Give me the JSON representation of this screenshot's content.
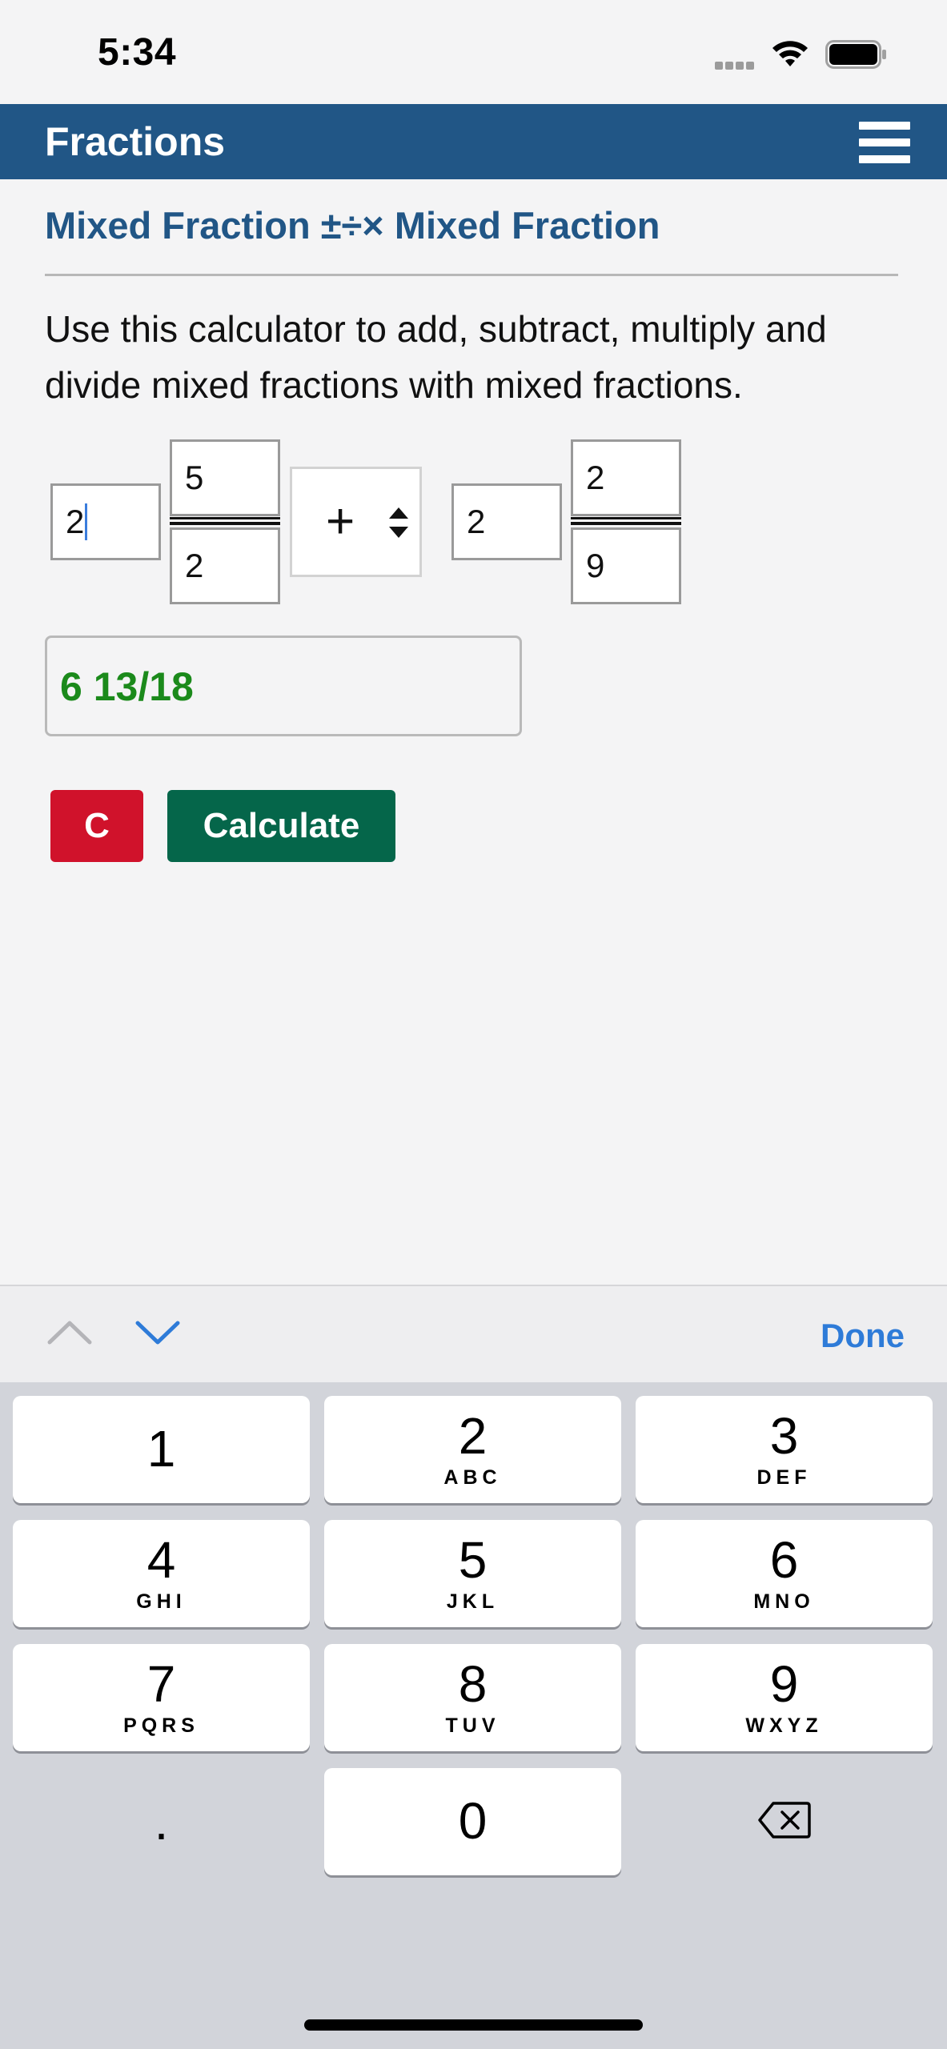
{
  "status_bar": {
    "time": "5:34"
  },
  "header": {
    "title": "Fractions"
  },
  "calculator": {
    "title": "Mixed Fraction ±÷× Mixed Fraction",
    "description": "Use this calculator to add, subtract, multiply and divide mixed fractions with mixed fractions.",
    "first": {
      "whole": "2",
      "numerator": "5",
      "denominator": "2"
    },
    "operator": "+",
    "second": {
      "whole": "2",
      "numerator": "2",
      "denominator": "9"
    },
    "result": "6 13/18",
    "clear_label": "C",
    "calculate_label": "Calculate"
  },
  "accessory": {
    "done_label": "Done"
  },
  "keyboard": {
    "keys": [
      {
        "digit": "1",
        "letters": ""
      },
      {
        "digit": "2",
        "letters": "ABC"
      },
      {
        "digit": "3",
        "letters": "DEF"
      },
      {
        "digit": "4",
        "letters": "GHI"
      },
      {
        "digit": "5",
        "letters": "JKL"
      },
      {
        "digit": "6",
        "letters": "MNO"
      },
      {
        "digit": "7",
        "letters": "PQRS"
      },
      {
        "digit": "8",
        "letters": "TUV"
      },
      {
        "digit": "9",
        "letters": "WXYZ"
      },
      {
        "digit": "0",
        "letters": ""
      }
    ],
    "decimal_label": "."
  },
  "colors": {
    "header": "#215686",
    "result": "#1b8a1b",
    "clear_button": "#d0122b",
    "calculate_button": "#05664a",
    "done": "#2e7bd8"
  }
}
